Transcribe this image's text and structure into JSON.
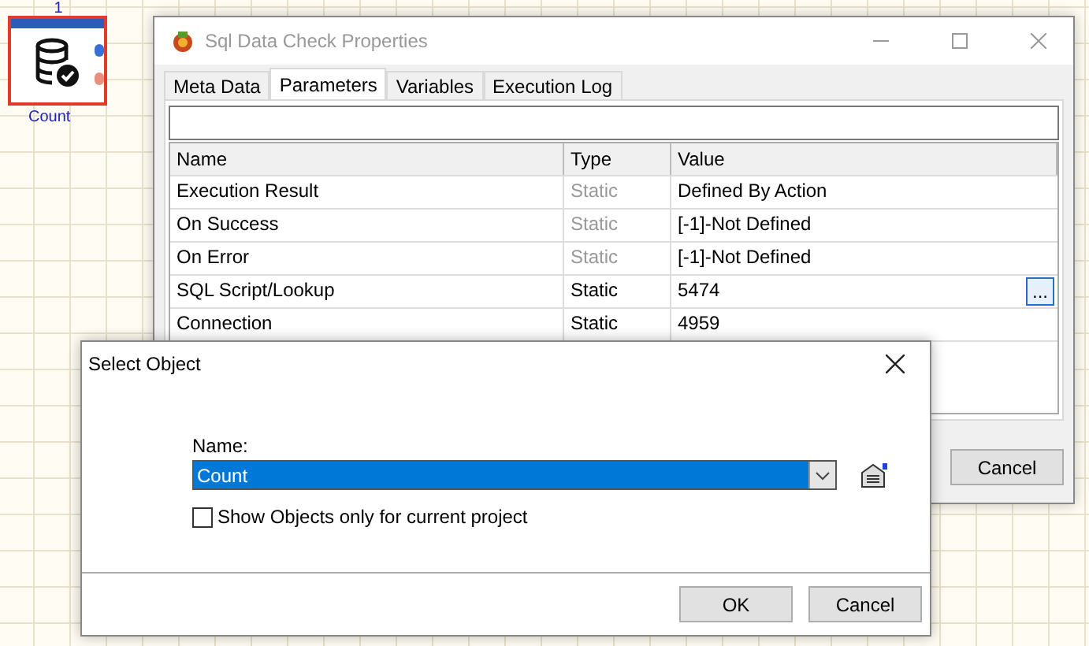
{
  "node": {
    "number": "1",
    "label": "Count"
  },
  "properties_window": {
    "title": "Sql Data Check Properties",
    "tabs": [
      {
        "label": "Meta Data",
        "selected": false
      },
      {
        "label": "Parameters",
        "selected": true
      },
      {
        "label": "Variables",
        "selected": false
      },
      {
        "label": "Execution Log",
        "selected": false
      }
    ],
    "table": {
      "columns": [
        "Name",
        "Type",
        "Value"
      ],
      "rows": [
        {
          "name": "Execution Result",
          "type": "Static",
          "type_disabled": true,
          "value": "Defined By Action"
        },
        {
          "name": "On Success",
          "type": "Static",
          "type_disabled": true,
          "value": "[-1]-Not Defined"
        },
        {
          "name": "On Error",
          "type": "Static",
          "type_disabled": true,
          "value": "[-1]-Not Defined"
        },
        {
          "name": "SQL Script/Lookup",
          "type": "Static",
          "type_disabled": false,
          "value": "5474",
          "button": "..."
        },
        {
          "name": "Connection",
          "type": "Static",
          "type_disabled": false,
          "value": "4959"
        }
      ]
    },
    "buttons": [
      "Cancel"
    ]
  },
  "select_dialog": {
    "title": "Select Object",
    "name_label": "Name:",
    "name_value": "Count",
    "checkbox": {
      "label": "Show Objects only for current project",
      "checked": false
    },
    "buttons": [
      "OK",
      "Cancel"
    ]
  }
}
